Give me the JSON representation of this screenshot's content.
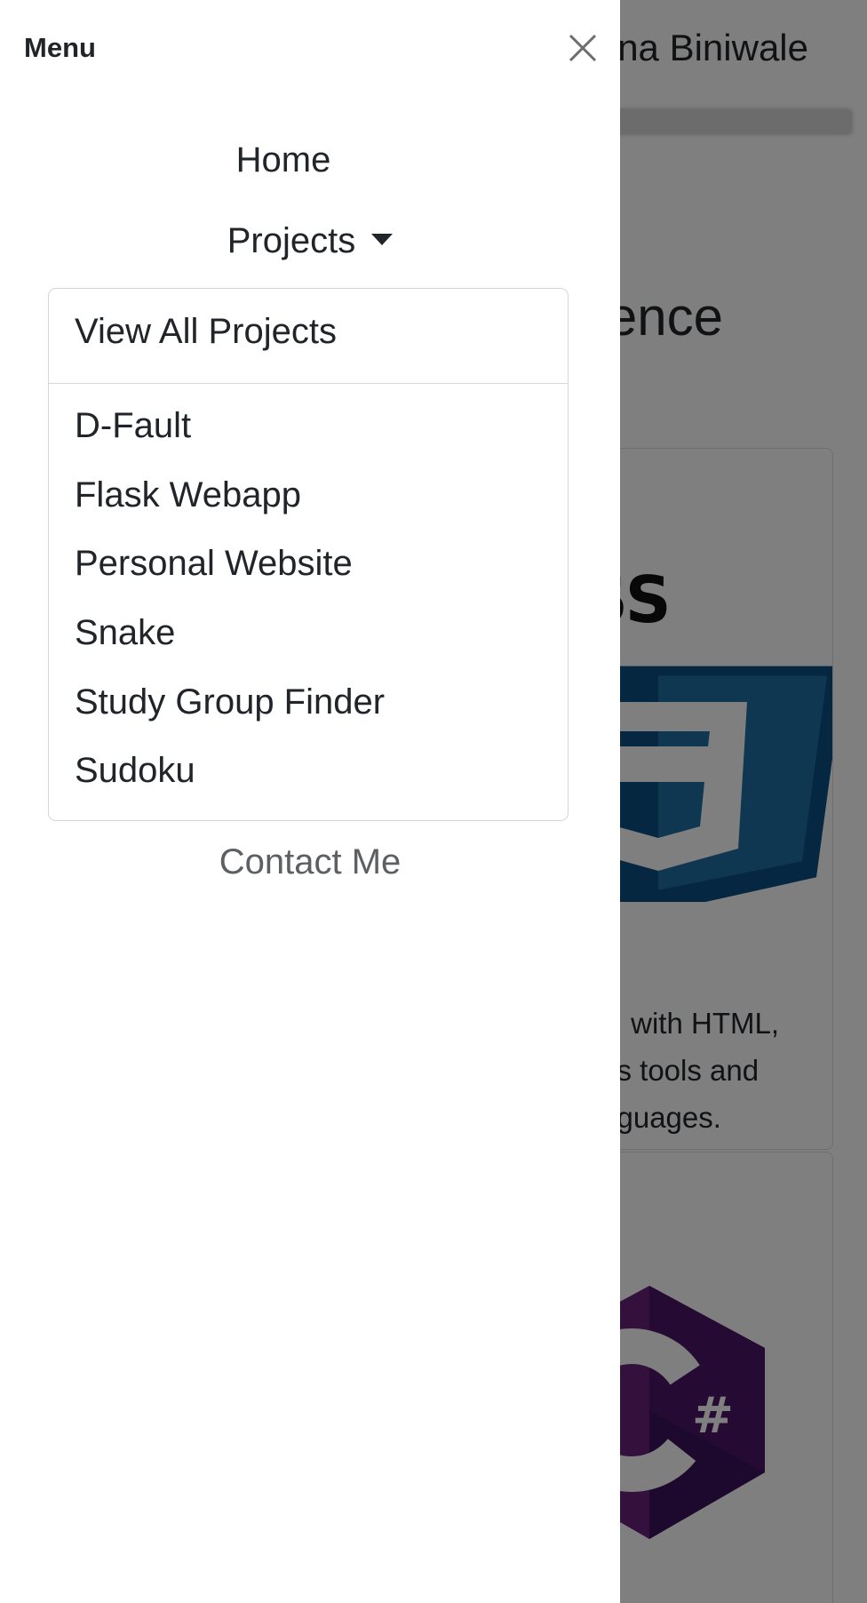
{
  "background": {
    "navbar_brand": "na Biniwale",
    "section_heading": "ence",
    "card1_text_lines": [
      "with HTML,",
      "us tools and",
      "nguages."
    ],
    "css_logo_text": "CSS",
    "cs_logo_text": "#"
  },
  "offcanvas": {
    "title": "Menu",
    "nav": {
      "home": "Home",
      "projects": "Projects",
      "contact": "Contact Me"
    },
    "dropdown": {
      "header_item": "View All Projects",
      "items": [
        "D-Fault",
        "Flask Webapp",
        "Personal Website",
        "Snake",
        "Study Group Finder",
        "Sudoku"
      ]
    }
  },
  "colors": {
    "text": "#212529",
    "muted": "#5c5f63",
    "css_blue_dark": "#0b4f82",
    "css_blue_light": "#1f6fa3",
    "csharp_purple": "#68217a",
    "overlay": "rgba(0,0,0,0.5)"
  }
}
